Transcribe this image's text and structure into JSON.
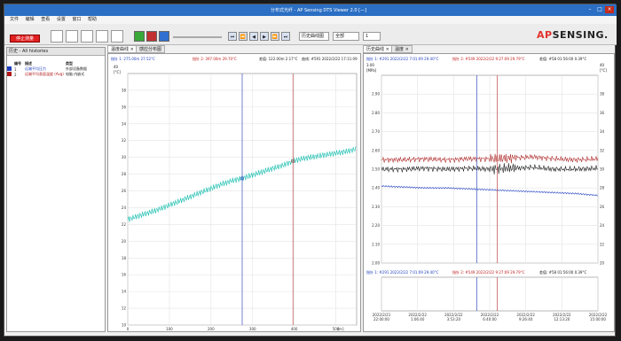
{
  "window": {
    "title": "分布式光纤 - AP Sensing DTS Viewer 2.0 [—]"
  },
  "menu": [
    "文件",
    "编辑",
    "查看",
    "设置",
    "窗口",
    "帮助"
  ],
  "toolbar": {
    "stop_label": "停止测量",
    "history_label": "历史曲线图",
    "range_label": "全部",
    "page_value": "1"
  },
  "logo": {
    "ap": "AP",
    "rest": "SENSING."
  },
  "history_panel": {
    "title": "历史 - All histories",
    "columns": [
      "编号",
      "描述",
      "类型"
    ],
    "rows": [
      {
        "num": "1",
        "desc": "远端平均压力",
        "type": "外部设备数据",
        "color": "#1f3fbf"
      },
      {
        "num": "2",
        "desc": "远端平均表面温度 (Avg)",
        "type": "电脑 内嵌式",
        "color": "#b01818"
      }
    ]
  },
  "left_chart": {
    "tabs": [
      "温度曲线 ×",
      "感应分布图"
    ],
    "header": {
      "cursor1": "指针 1: 275.00m 27.52°C",
      "cursor2": "指针 2: 397.00m 29.70°C",
      "delta": "差值: 122.00m 2.17°C",
      "trace": "曲线: #591 2022/2/22 17:11:09"
    },
    "yunit_top": "40",
    "yunit": "[°C]",
    "xunit": "[m]"
  },
  "right_chart": {
    "tabs": [
      "历史曲线 ×",
      "温度 ×"
    ],
    "header_top": {
      "cursor1": "指针 1: #291 2022/2/22 7:01:09 29.40°C",
      "cursor2": "指针 2: #549 2022/2/22 9:27:09 29.79°C",
      "delta": "差值: #58 01:56:00 0.39°C"
    },
    "header_bottom": {
      "cursor1": "指针 1: #291 2022/2/22 7:01:09 29.40°C",
      "cursor2": "指针 2: #549 2022/2/22 9:27:09 29.79°C",
      "delta": "差值: #58 01:56:00 0.39°C"
    },
    "left_unit_top": "3.00",
    "left_unit": "[MPa]",
    "right_unit_top": "40",
    "right_unit": "[°C]"
  },
  "chart_data": [
    {
      "type": "line",
      "xlabel": "[m]",
      "ylabel": "[°C]",
      "xlim": [
        0,
        550
      ],
      "ylim": [
        10,
        40
      ],
      "x_ticks": [
        "0",
        "100",
        "200",
        "300",
        "400",
        "500"
      ],
      "y_ticks": [
        "10",
        "12",
        "14",
        "16",
        "18",
        "20",
        "22",
        "24",
        "26",
        "28",
        "30",
        "32",
        "34",
        "36",
        "38"
      ],
      "series": [
        {
          "color": "#2ec4b6",
          "x": [
            0,
            25,
            50,
            75,
            100,
            125,
            150,
            175,
            200,
            225,
            250,
            275,
            300,
            325,
            350,
            375,
            400,
            425,
            450,
            475,
            500,
            525,
            550
          ],
          "y": [
            22.6,
            23.0,
            23.4,
            23.8,
            24.3,
            24.8,
            25.3,
            25.8,
            26.3,
            26.8,
            27.2,
            27.5,
            27.9,
            28.3,
            28.7,
            29.1,
            29.6,
            29.9,
            30.1,
            30.3,
            30.5,
            30.7,
            31.0
          ]
        }
      ],
      "cursors": [
        275,
        397
      ]
    },
    {
      "type": "line",
      "ylabel": "[MPa]",
      "y2label": "[°C]",
      "x_ticks": [
        "2022/2/21\n22:00:00",
        "2022/2/22\n1:06:40",
        "2022/2/22\n3:53:20",
        "2022/2/22\n6:40:00",
        "2022/2/22\n9:26:40",
        "2022/2/22\n12:13:20",
        "2022/2/22\n15:00:00"
      ],
      "ylim": [
        2.0,
        3.0
      ],
      "y2lim": [
        20,
        40
      ],
      "y_ticks": [
        "2.00",
        "2.10",
        "2.20",
        "2.30",
        "2.40",
        "2.50",
        "2.60",
        "2.70",
        "2.80",
        "2.90"
      ],
      "y2_ticks": [
        "20",
        "22",
        "24",
        "26",
        "28",
        "30",
        "32",
        "34",
        "36",
        "38"
      ],
      "series": [
        {
          "color": "#b03030",
          "axis": "y2",
          "x": [
            0,
            0.1,
            0.2,
            0.3,
            0.4,
            0.5,
            0.6,
            0.7,
            0.8,
            0.9,
            1.0
          ],
          "y": [
            31.0,
            31.0,
            31.1,
            31.0,
            31.1,
            31.1,
            31.2,
            31.3,
            31.1,
            31.0,
            31.1
          ]
        },
        {
          "color": "#222222",
          "axis": "y2",
          "x": [
            0,
            0.1,
            0.2,
            0.3,
            0.4,
            0.5,
            0.6,
            0.7,
            0.8,
            0.9,
            1.0
          ],
          "y": [
            30.0,
            30.0,
            30.1,
            30.0,
            30.1,
            30.0,
            30.1,
            30.2,
            30.0,
            30.0,
            30.1
          ]
        },
        {
          "color": "#2040c0",
          "axis": "y",
          "x": [
            0,
            0.1,
            0.2,
            0.3,
            0.4,
            0.5,
            0.6,
            0.7,
            0.8,
            0.9,
            1.0
          ],
          "y": [
            2.41,
            2.405,
            2.4,
            2.4,
            2.395,
            2.39,
            2.385,
            2.38,
            2.375,
            2.37,
            2.36
          ]
        }
      ],
      "cursors": [
        0.44,
        0.535
      ]
    }
  ]
}
